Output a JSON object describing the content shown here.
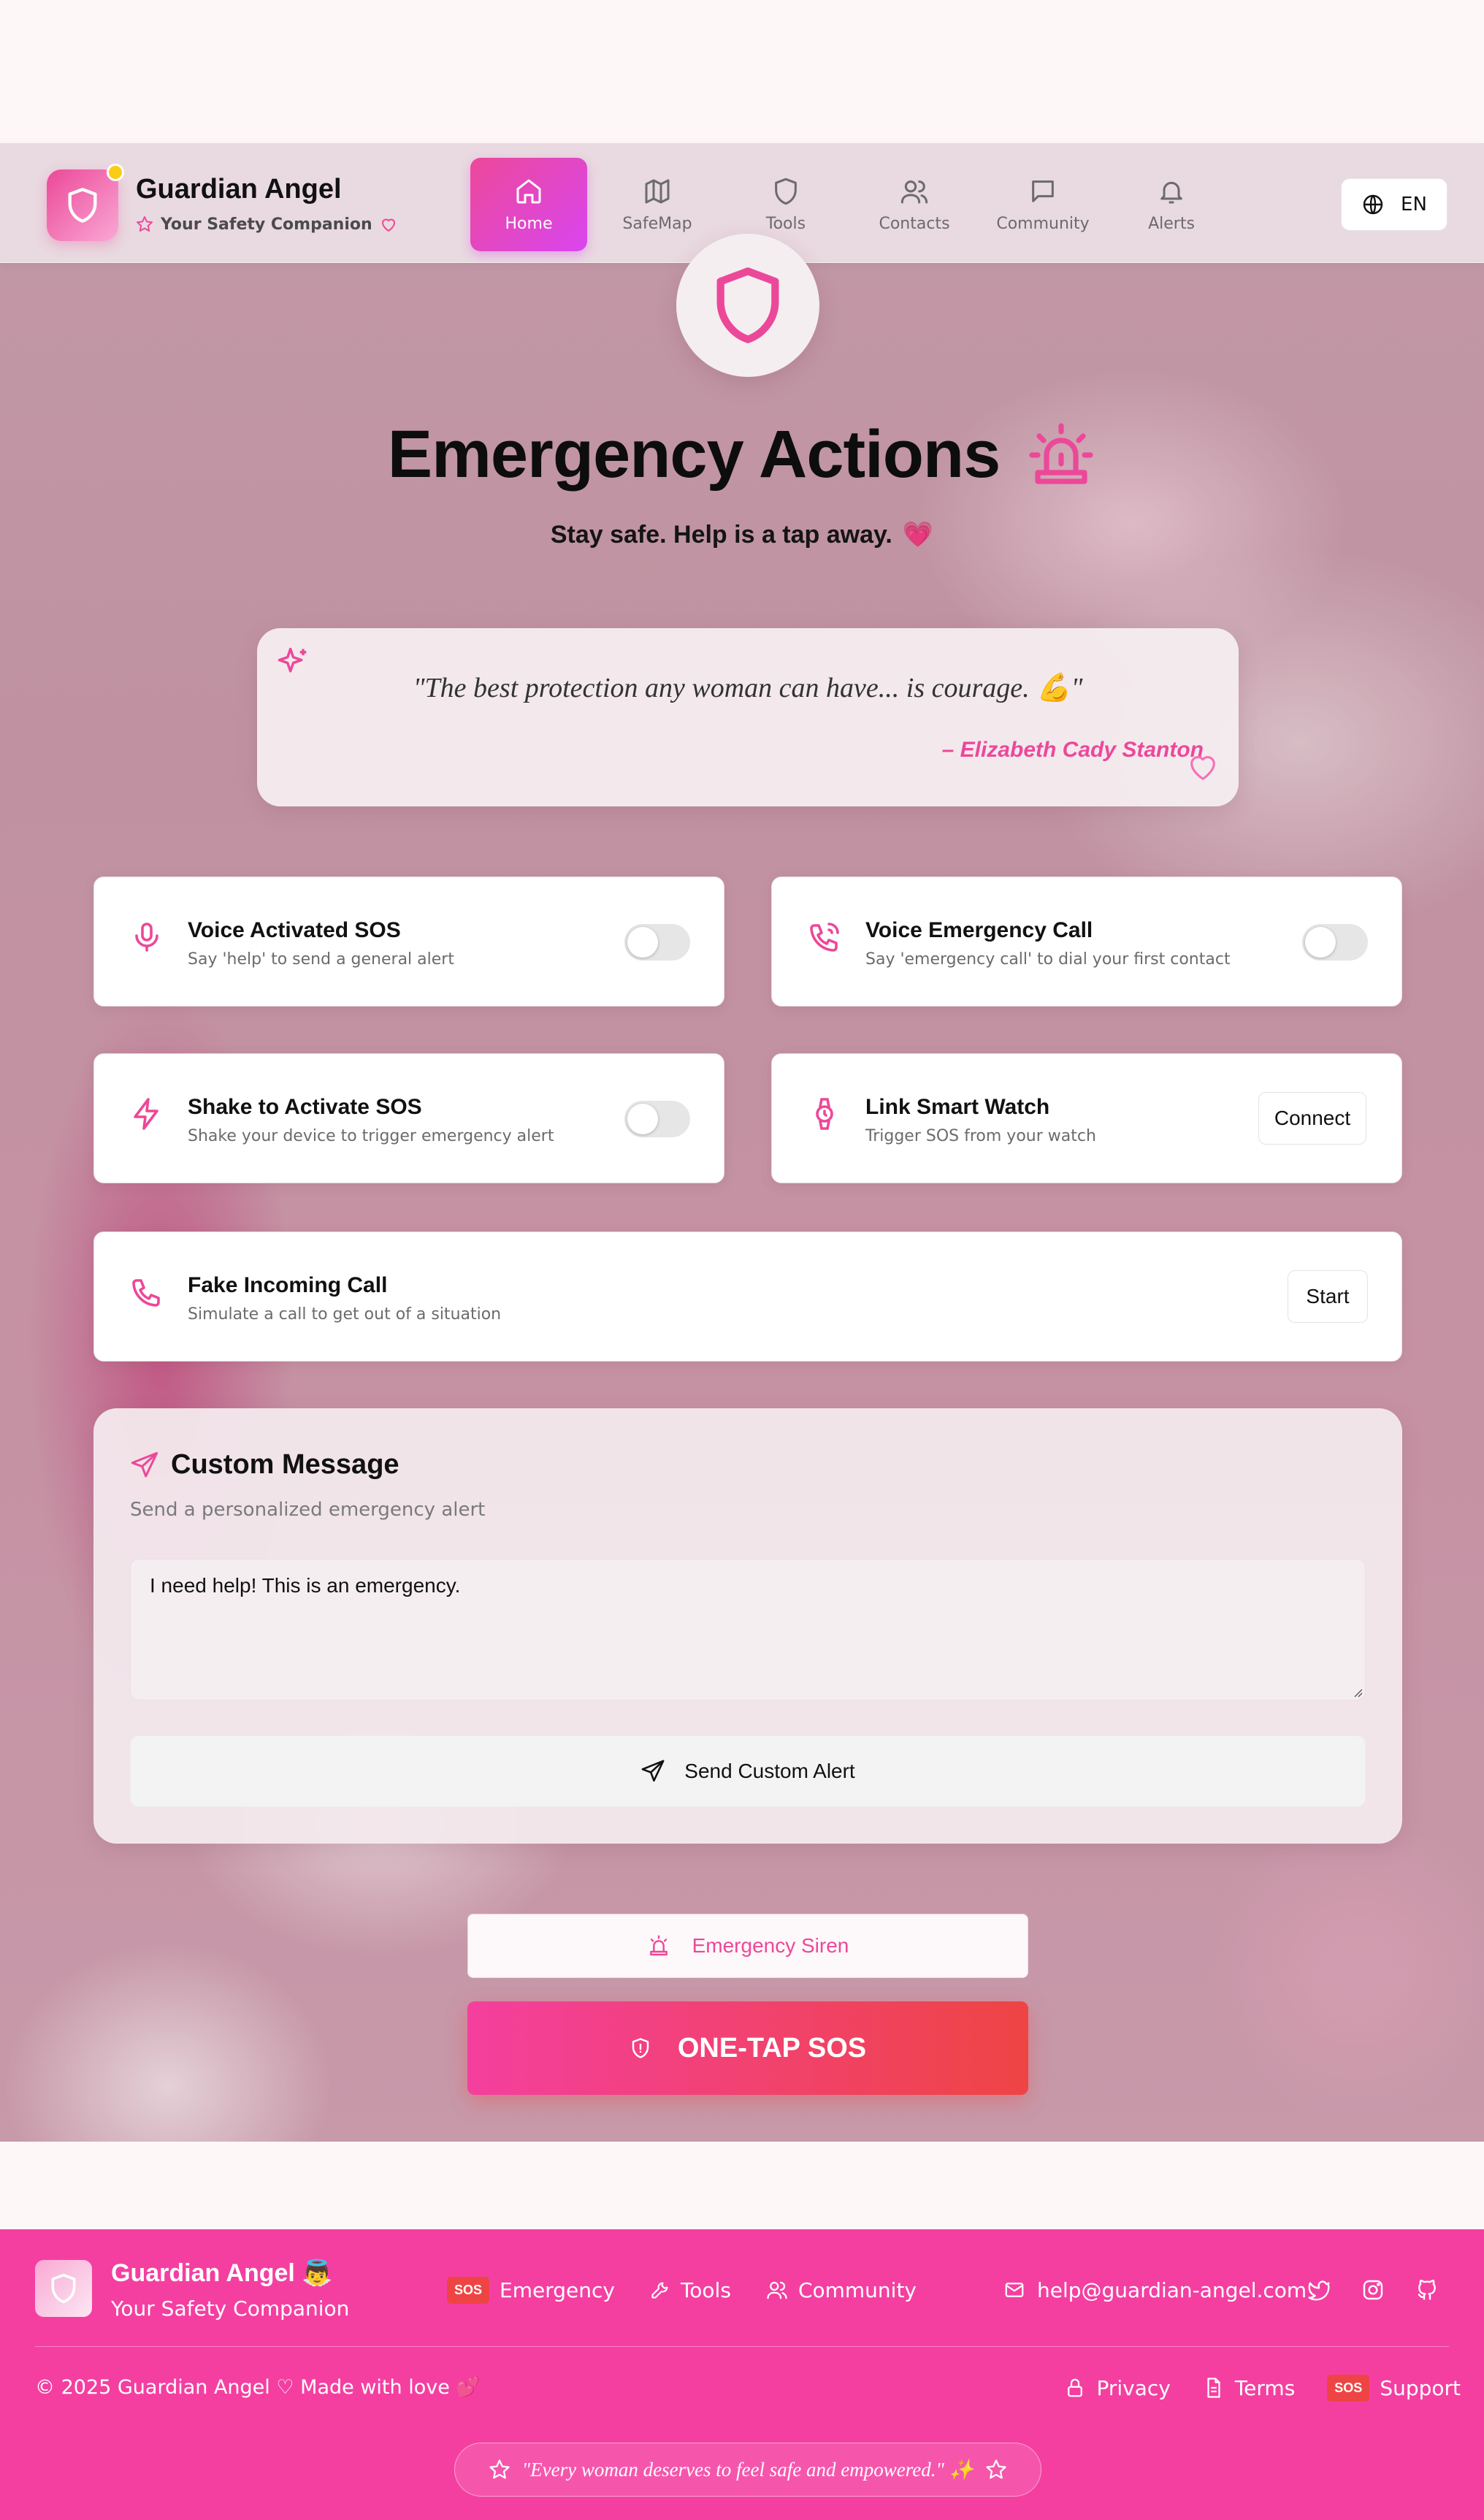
{
  "header": {
    "brand_title": "Guardian Angel",
    "brand_subtitle": "Your Safety Companion",
    "nav": [
      {
        "label": "Home",
        "icon": "home-icon",
        "active": true
      },
      {
        "label": "SafeMap",
        "icon": "map-icon",
        "active": false
      },
      {
        "label": "Tools",
        "icon": "shield-icon",
        "active": false
      },
      {
        "label": "Contacts",
        "icon": "users-icon",
        "active": false
      },
      {
        "label": "Community",
        "icon": "chat-icon",
        "active": false
      },
      {
        "label": "Alerts",
        "icon": "bell-icon",
        "active": false
      }
    ],
    "language": "EN"
  },
  "hero": {
    "title": "Emergency Actions",
    "subtitle": "Stay safe. Help is a tap away.",
    "subtitle_emoji": "💗"
  },
  "quote": {
    "text": "\"The best protection any woman can have... is courage. 💪\"",
    "author": "– Elizabeth Cady Stanton"
  },
  "features": [
    {
      "title": "Voice Activated SOS",
      "subtitle": "Say 'help' to send a general alert",
      "icon": "microphone-icon",
      "control": "toggle",
      "enabled": false
    },
    {
      "title": "Voice Emergency Call",
      "subtitle": "Say 'emergency call' to dial your first contact",
      "icon": "phone-call-icon",
      "control": "toggle",
      "enabled": false
    },
    {
      "title": "Shake to Activate SOS",
      "subtitle": "Shake your device to trigger emergency alert",
      "icon": "lightning-icon",
      "control": "toggle",
      "enabled": false
    },
    {
      "title": "Link Smart Watch",
      "subtitle": "Trigger SOS from your watch",
      "icon": "watch-icon",
      "control": "button",
      "button_label": "Connect"
    },
    {
      "title": "Fake Incoming Call",
      "subtitle": "Simulate a call to get out of a situation",
      "icon": "phone-icon",
      "control": "button",
      "button_label": "Start"
    }
  ],
  "custom_message": {
    "title": "Custom Message",
    "subtitle": "Send a personalized emergency alert",
    "message": "I need help! This is an emergency.",
    "send_label": "Send Custom Alert"
  },
  "actions": {
    "siren_label": "Emergency Siren",
    "sos_label": "ONE-TAP SOS"
  },
  "footer": {
    "brand_title": "Guardian Angel 👼",
    "brand_subtitle": "Your Safety Companion",
    "sos_badge": "SOS",
    "links": [
      "Emergency",
      "Tools",
      "Community"
    ],
    "email": "help@guardian-angel.com",
    "copyright": "© 2025 Guardian Angel ♡ Made with love 💕",
    "legal": [
      "Privacy",
      "Terms",
      "Support"
    ],
    "tagline": "\"Every woman deserves to feel safe and empowered.\" ✨"
  },
  "colors": {
    "accent": "#ec4899",
    "nav_active_gradient": [
      "#ec4899",
      "#d946ef"
    ],
    "sos_gradient": [
      "#f43f9e",
      "#ef4444"
    ],
    "footer_bg": "#f43fa1"
  }
}
